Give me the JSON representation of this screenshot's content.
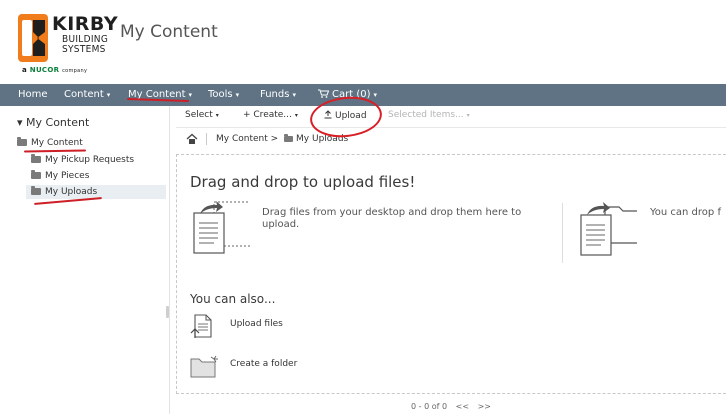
{
  "header": {
    "logo": {
      "line1": "KIRBY",
      "line2": "BUILDING",
      "line3": "SYSTEMS",
      "tagline_prefix": "a",
      "tagline_brand": "NUCOR",
      "tagline_suffix": "company"
    },
    "page_title": "My Content"
  },
  "nav": {
    "items": [
      {
        "label": "Home",
        "has_caret": false
      },
      {
        "label": "Content",
        "has_caret": true
      },
      {
        "label": "My Content",
        "has_caret": true
      },
      {
        "label": "Tools",
        "has_caret": true
      },
      {
        "label": "Funds",
        "has_caret": true
      },
      {
        "label": "Cart (0)",
        "has_caret": true
      }
    ],
    "caret": "▾"
  },
  "sidebar": {
    "title": "▾ My Content",
    "items": [
      {
        "label": "My Content"
      },
      {
        "label": "My Pickup Requests"
      },
      {
        "label": "My Pieces"
      },
      {
        "label": "My Uploads"
      }
    ]
  },
  "toolbar": {
    "select_label": "Select",
    "create_label": "+ Create...",
    "upload_label": "Upload",
    "selected_items_label": "Selected Items...",
    "caret": "▾",
    "upload_icon": "upload-arrow-icon"
  },
  "breadcrumb": {
    "root": "My Content",
    "separator": ">",
    "current": "My Uploads"
  },
  "dropzone": {
    "heading": "Drag and drop to upload files!",
    "desc": "Drag files from your desktop and drop them here to upload.",
    "desc2": "You can drop f",
    "also_heading": "You can also...",
    "upload_files_label": "Upload files",
    "create_folder_label": "Create a folder"
  },
  "pager": {
    "range": "0 - 0 of 0",
    "prev": "<<",
    "next": ">>"
  },
  "colors": {
    "navbar": "#5f7384",
    "annotation_red": "#d81f26",
    "logo_orange": "#f07c1c",
    "nucor_green": "#0b7f3a"
  }
}
